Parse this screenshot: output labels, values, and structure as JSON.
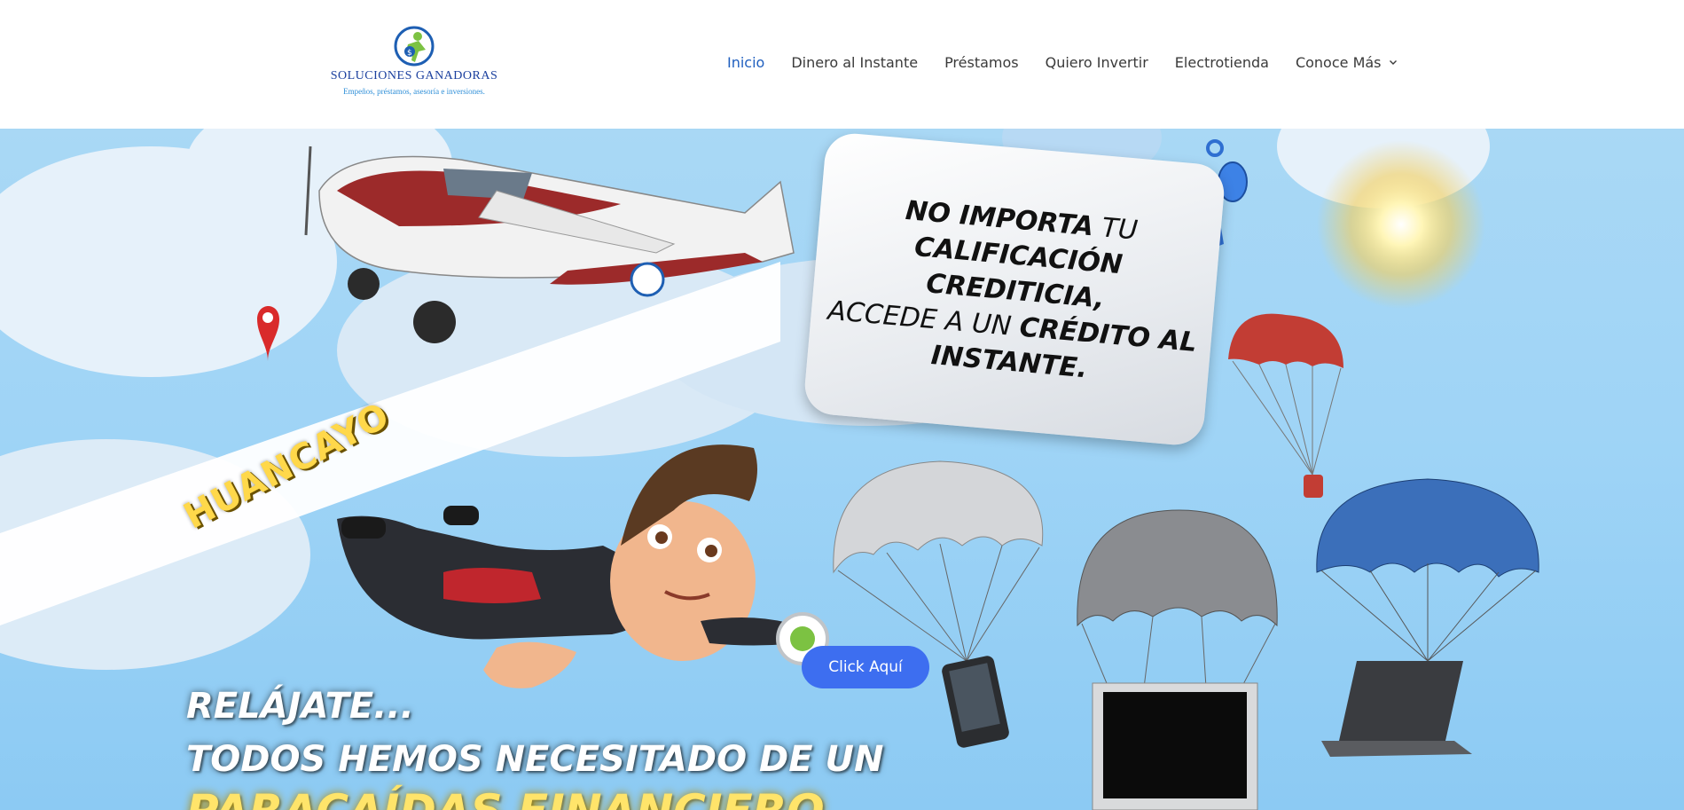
{
  "header": {
    "logo": {
      "name": "SOLUCIONES GANADORAS",
      "tagline": "Empeños, préstamos, asesoría e inversiones."
    },
    "nav": [
      {
        "label": "Inicio",
        "active": true
      },
      {
        "label": "Dinero al Instante",
        "active": false
      },
      {
        "label": "Préstamos",
        "active": false
      },
      {
        "label": "Quiero Invertir",
        "active": false
      },
      {
        "label": "Electrotienda",
        "active": false
      },
      {
        "label": "Conoce Más",
        "active": false,
        "has_dropdown": true
      }
    ]
  },
  "hero": {
    "bubble": {
      "line1_bold": "NO IMPORTA",
      "line1_thin": " TU",
      "line2_bold": "CALIFICACIÓN CREDITICIA,",
      "line3_thin": "ACCEDE A UN ",
      "line3_bold": "CRÉDITO AL",
      "line4_bold": "INSTANTE."
    },
    "location_banner": "HUANCAYO",
    "cta_label": "Click Aquí",
    "headline": {
      "line1": "RELÁJATE...",
      "line2": "TODOS HEMOS NECESITADO DE UN",
      "line3": "PARACAÍDAS FINANCIERO"
    }
  },
  "colors": {
    "nav_active": "#1f5fbf",
    "cta": "#3d6ef0",
    "sky": "#9fd4f6",
    "banner_text": "#ffd84a"
  }
}
